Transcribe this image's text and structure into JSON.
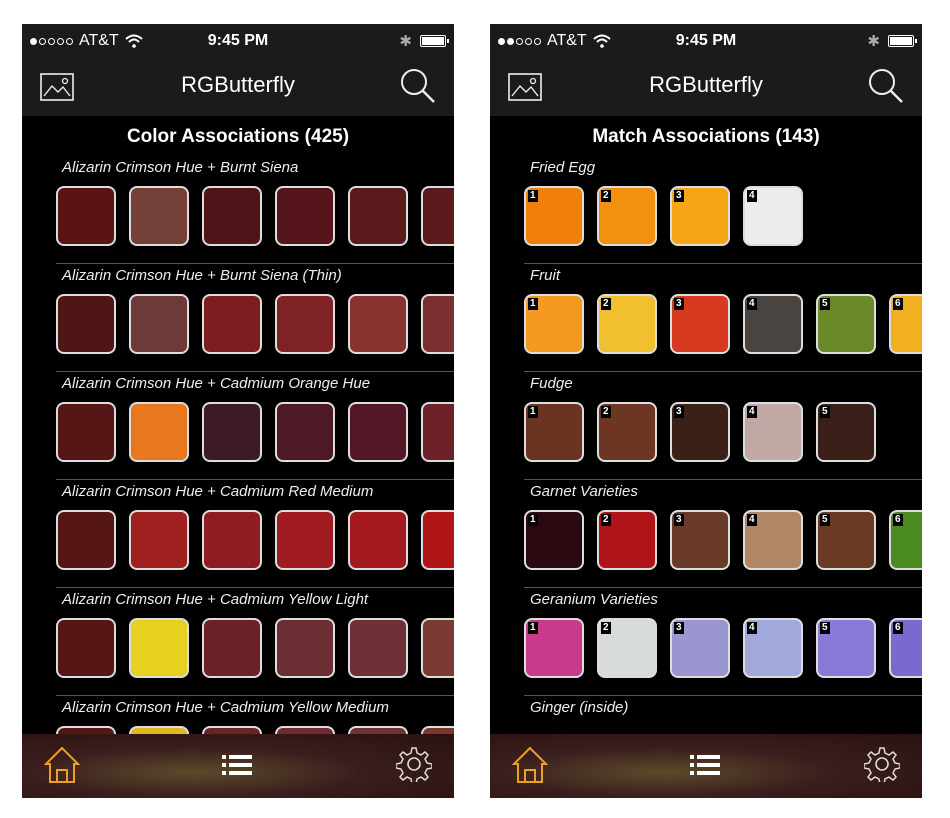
{
  "accent_color": "#f0a020",
  "screens": [
    {
      "status": {
        "carrier": "AT&T",
        "time": "9:45 PM"
      },
      "nav_title": "RGButterfly",
      "section_title": "Color Associations (425)",
      "groups": [
        {
          "label": "Alizarin Crimson Hue + Burnt Siena",
          "swatches": [
            {
              "color": "#5a1414"
            },
            {
              "color": "#744038"
            },
            {
              "color": "#4e1418"
            },
            {
              "color": "#56151a"
            },
            {
              "color": "#5a1a1c"
            },
            {
              "color": "#5c1a1c"
            }
          ]
        },
        {
          "label": "Alizarin Crimson Hue + Burnt Siena (Thin)",
          "swatches": [
            {
              "color": "#501616"
            },
            {
              "color": "#6e3a38"
            },
            {
              "color": "#7c1e20"
            },
            {
              "color": "#7e2226"
            },
            {
              "color": "#8a3432"
            },
            {
              "color": "#7a302e"
            }
          ]
        },
        {
          "label": "Alizarin Crimson Hue + Cadmium Orange Hue",
          "swatches": [
            {
              "color": "#561616"
            },
            {
              "color": "#e8771e"
            },
            {
              "color": "#3e1a26"
            },
            {
              "color": "#4e1824"
            },
            {
              "color": "#521624"
            },
            {
              "color": "#6c2228"
            }
          ]
        },
        {
          "label": "Alizarin Crimson Hue + Cadmium Red Medium",
          "swatches": [
            {
              "color": "#561616"
            },
            {
              "color": "#a02020"
            },
            {
              "color": "#8e1c22"
            },
            {
              "color": "#a01c20"
            },
            {
              "color": "#a41a1e"
            },
            {
              "color": "#b01416"
            }
          ]
        },
        {
          "label": "Alizarin Crimson Hue + Cadmium Yellow Light",
          "swatches": [
            {
              "color": "#561616"
            },
            {
              "color": "#e6d020"
            },
            {
              "color": "#6a2226"
            },
            {
              "color": "#6c2e32"
            },
            {
              "color": "#6e3034"
            },
            {
              "color": "#7a3a32"
            }
          ]
        },
        {
          "label": "Alizarin Crimson Hue + Cadmium Yellow Medium",
          "swatches": [
            {
              "color": "#561616"
            },
            {
              "color": "#e0b820"
            },
            {
              "color": "#6a2426"
            },
            {
              "color": "#6e2c30"
            },
            {
              "color": "#703034"
            },
            {
              "color": "#7a3630"
            }
          ]
        }
      ]
    },
    {
      "status": {
        "carrier": "AT&T",
        "time": "9:45 PM"
      },
      "nav_title": "RGButterfly",
      "section_title": "Match Associations (143)",
      "groups": [
        {
          "label": "Fried Egg",
          "swatches": [
            {
              "color": "#f08008",
              "num": "1"
            },
            {
              "color": "#f29010",
              "num": "2"
            },
            {
              "color": "#f6a614",
              "num": "3"
            },
            {
              "color": "#ececea",
              "num": "4"
            }
          ]
        },
        {
          "label": "Fruit",
          "swatches": [
            {
              "color": "#f59a20",
              "num": "1"
            },
            {
              "color": "#f0c030",
              "num": "2"
            },
            {
              "color": "#d83a20",
              "num": "3"
            },
            {
              "color": "#4a4440",
              "num": "4"
            },
            {
              "color": "#6a8a2a",
              "num": "5"
            },
            {
              "color": "#f0b020",
              "num": "6"
            }
          ]
        },
        {
          "label": "Fudge",
          "swatches": [
            {
              "color": "#6a3420",
              "num": "1"
            },
            {
              "color": "#6c3622",
              "num": "2"
            },
            {
              "color": "#3a2016",
              "num": "3"
            },
            {
              "color": "#c0a8a4",
              "num": "4"
            },
            {
              "color": "#3a2018",
              "num": "5"
            }
          ]
        },
        {
          "label": "Garnet Varieties",
          "swatches": [
            {
              "color": "#2a0a10",
              "num": "1"
            },
            {
              "color": "#b01418",
              "num": "2"
            },
            {
              "color": "#6a3a28",
              "num": "3"
            },
            {
              "color": "#b08868",
              "num": "4"
            },
            {
              "color": "#6a3a22",
              "num": "5"
            },
            {
              "color": "#4a8a20",
              "num": "6"
            }
          ]
        },
        {
          "label": "Geranium Varieties",
          "swatches": [
            {
              "color": "#c83a8a",
              "num": "1"
            },
            {
              "color": "#d8dcd8",
              "num": "2"
            },
            {
              "color": "#9a96d0",
              "num": "3"
            },
            {
              "color": "#a0a8dc",
              "num": "4"
            },
            {
              "color": "#8a7ad8",
              "num": "5"
            },
            {
              "color": "#7a6ad0",
              "num": "6"
            }
          ]
        },
        {
          "label": "Ginger (inside)",
          "swatches": []
        }
      ]
    }
  ]
}
